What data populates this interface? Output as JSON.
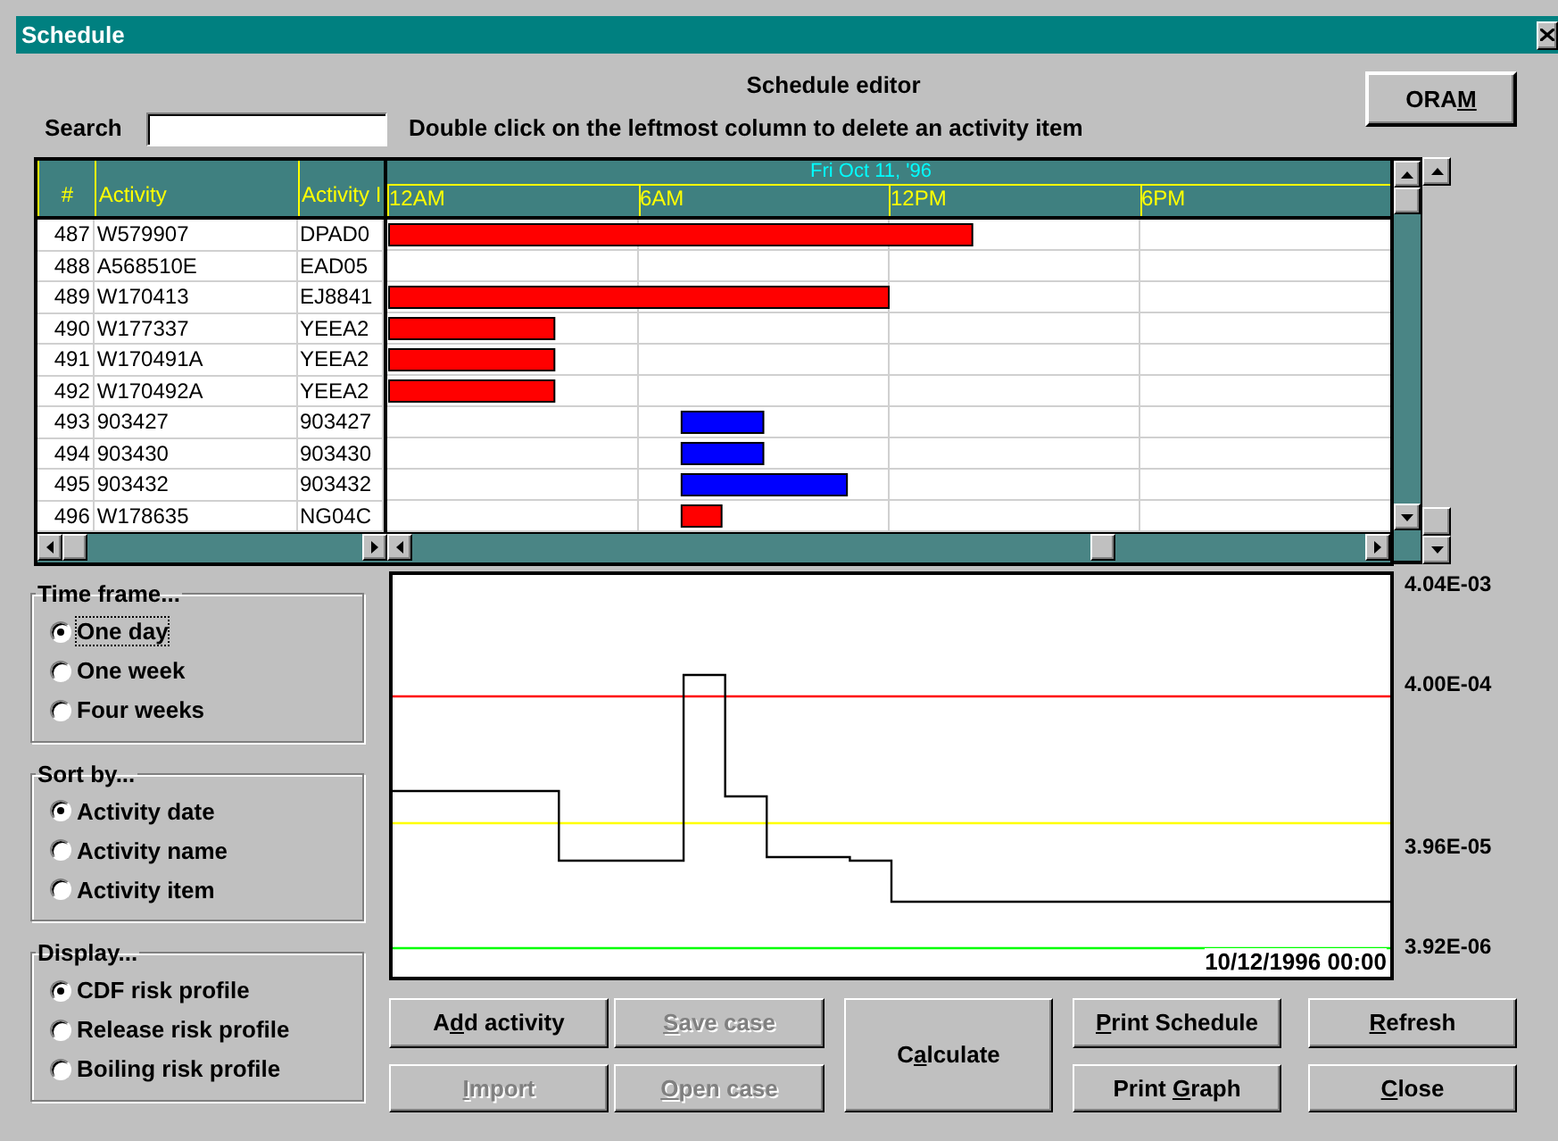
{
  "window": {
    "title": "Schedule"
  },
  "heading": "Schedule editor",
  "oram_button": {
    "before": "ORA",
    "key": "M"
  },
  "search": {
    "label": "Search"
  },
  "hint": "Double click on the leftmost column to delete an activity item",
  "table": {
    "columns": [
      "#",
      "Activity",
      "Activity I"
    ],
    "rows": [
      {
        "cells": [
          "487",
          "W579907",
          "DPAD0"
        ]
      },
      {
        "cells": [
          "488",
          "A568510E",
          "EAD05"
        ]
      },
      {
        "cells": [
          "489",
          "W170413",
          "EJ8841"
        ]
      },
      {
        "cells": [
          "490",
          "W177337",
          "YEEA2"
        ]
      },
      {
        "cells": [
          "491",
          "W170491A",
          "YEEA2"
        ]
      },
      {
        "cells": [
          "492",
          "W170492A",
          "YEEA2"
        ]
      },
      {
        "cells": [
          "493",
          "903427",
          "903427"
        ]
      },
      {
        "cells": [
          "494",
          "903430",
          "903430"
        ]
      },
      {
        "cells": [
          "495",
          "903432",
          "903432"
        ]
      },
      {
        "cells": [
          "496",
          "W178635",
          "NG04C"
        ]
      }
    ]
  },
  "timeline": {
    "date": "Fri Oct 11, '96",
    "ticks": [
      "12AM",
      "6AM",
      "12PM",
      "6PM"
    ]
  },
  "groups": [
    {
      "title": "Time frame...",
      "options": [
        {
          "label": "One day",
          "selected": true,
          "focused": true
        },
        {
          "label": "One week",
          "selected": false,
          "focused": false
        },
        {
          "label": "Four weeks",
          "selected": false,
          "focused": false
        }
      ]
    },
    {
      "title": "Sort by...",
      "options": [
        {
          "label": "Activity date",
          "selected": true,
          "focused": false
        },
        {
          "label": "Activity name",
          "selected": false,
          "focused": false
        },
        {
          "label": "Activity item",
          "selected": false,
          "focused": false
        }
      ]
    },
    {
      "title": "Display...",
      "options": [
        {
          "label": "CDF risk profile",
          "selected": true,
          "focused": false
        },
        {
          "label": "Release risk profile",
          "selected": false,
          "focused": false
        },
        {
          "label": "Boiling risk profile",
          "selected": false,
          "focused": false
        }
      ]
    }
  ],
  "risk_chart": {
    "time_label": "10/12/1996 00:00",
    "y_labels": [
      "4.04E-03",
      "4.00E-04",
      "3.96E-05",
      "3.92E-06"
    ]
  },
  "button_columns": [
    [
      {
        "before": "A",
        "key": "d",
        "after": "d activity",
        "disabled": false
      },
      {
        "key": "I",
        "after": "mport",
        "disabled": true
      }
    ],
    [
      {
        "key": "S",
        "after": "ave case",
        "disabled": true
      },
      {
        "key": "O",
        "after": "pen case",
        "disabled": true
      }
    ],
    [
      {
        "before": "C",
        "key": "a",
        "after": "lculate",
        "disabled": false
      }
    ],
    [
      {
        "key": "P",
        "after": "rint Schedule",
        "disabled": false
      },
      {
        "before": "Print ",
        "key": "G",
        "after": "raph",
        "disabled": false
      }
    ],
    [
      {
        "key": "R",
        "after": "efresh",
        "disabled": false
      },
      {
        "key": "C",
        "after": "lose",
        "disabled": false
      }
    ]
  ]
}
